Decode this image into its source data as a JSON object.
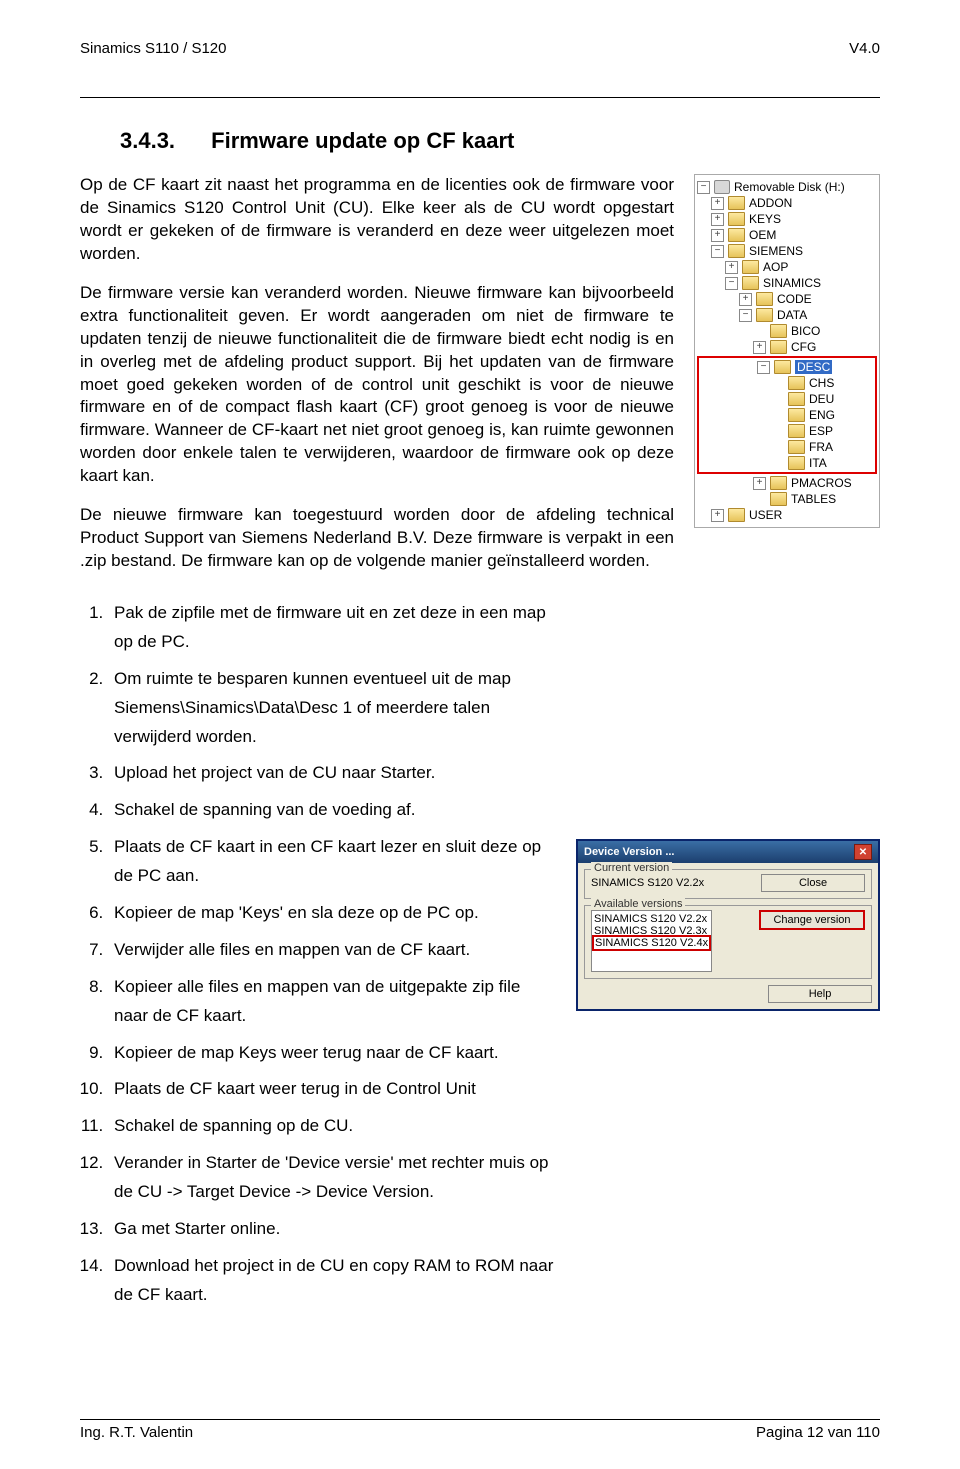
{
  "header": {
    "left": "Sinamics S110 / S120",
    "right": "V4.0"
  },
  "heading": {
    "num": "3.4.3.",
    "title": "Firmware update op CF kaart"
  },
  "paragraphs": {
    "p1": "Op de CF kaart zit naast het programma en de licenties ook de firmware voor de Sinamics S120 Control Unit (CU). Elke keer als de CU wordt opgestart wordt er gekeken of de firmware is veranderd en deze weer uitgelezen moet worden.",
    "p2": "De firmware versie kan veranderd worden. Nieuwe firmware kan bijvoorbeeld extra functionaliteit geven. Er wordt aangeraden om niet de firmware te updaten tenzij de nieuwe functionaliteit die de firmware biedt echt nodig is en in overleg met de afdeling product support. Bij het updaten van de firmware moet goed gekeken worden of de control unit geschikt is voor de nieuwe firmware en of de compact flash kaart (CF) groot genoeg is voor de nieuwe firmware. Wanneer de CF-kaart net niet groot genoeg is, kan ruimte gewonnen worden door enkele talen te verwijderen, waardoor de firmware ook op deze kaart kan.",
    "p3": "De nieuwe firmware kan toegestuurd worden door de afdeling technical Product Support van Siemens Nederland B.V. Deze firmware is verpakt in een .zip bestand. De firmware kan op de volgende manier geïnstalleerd worden."
  },
  "tree": {
    "root": "Removable Disk (H:)",
    "nodes": [
      {
        "lvl": 2,
        "pm": "+",
        "label": "ADDON"
      },
      {
        "lvl": 2,
        "pm": "+",
        "label": "KEYS"
      },
      {
        "lvl": 2,
        "pm": "+",
        "label": "OEM"
      },
      {
        "lvl": 2,
        "pm": "-",
        "label": "SIEMENS"
      },
      {
        "lvl": 3,
        "pm": "+",
        "label": "AOP"
      },
      {
        "lvl": 3,
        "pm": "-",
        "label": "SINAMICS"
      },
      {
        "lvl": 4,
        "pm": "+",
        "label": "CODE"
      },
      {
        "lvl": 4,
        "pm": "-",
        "label": "DATA"
      },
      {
        "lvl": 5,
        "pm": " ",
        "label": "BICO"
      },
      {
        "lvl": 5,
        "pm": "+",
        "label": "CFG"
      },
      {
        "lvl": 5,
        "pm": "-",
        "label": "DESC",
        "selected": true,
        "redstart": true
      },
      {
        "lvl": 6,
        "pm": " ",
        "label": "CHS"
      },
      {
        "lvl": 6,
        "pm": " ",
        "label": "DEU"
      },
      {
        "lvl": 6,
        "pm": " ",
        "label": "ENG"
      },
      {
        "lvl": 6,
        "pm": " ",
        "label": "ESP"
      },
      {
        "lvl": 6,
        "pm": " ",
        "label": "FRA"
      },
      {
        "lvl": 6,
        "pm": " ",
        "label": "ITA",
        "redend": true
      },
      {
        "lvl": 5,
        "pm": "+",
        "label": "PMACROS"
      },
      {
        "lvl": 5,
        "pm": " ",
        "label": "TABLES"
      },
      {
        "lvl": 2,
        "pm": "+",
        "label": "USER"
      }
    ]
  },
  "steps": [
    "Pak de zipfile met de firmware uit en zet deze in een map op de PC.",
    "Om ruimte te besparen kunnen eventueel uit de map Siemens\\Sinamics\\Data\\Desc 1 of meerdere talen verwijderd worden.",
    "Upload het project van de CU naar Starter.",
    "Schakel de spanning van de voeding af.",
    "Plaats de CF kaart in een CF kaart lezer en sluit deze op de PC aan.",
    "Kopieer de map 'Keys' en sla deze op de PC op.",
    "Verwijder alle files en mappen van de CF kaart.",
    "Kopieer alle files en mappen van de uitgepakte zip file naar de CF kaart.",
    "Kopieer de map Keys weer terug naar de CF kaart.",
    "Plaats de CF kaart weer terug in de Control Unit",
    "Schakel de spanning op de CU.",
    "Verander in Starter de 'Device versie' met rechter muis op de CU -> Target Device -> Device Version.",
    "Ga met Starter online.",
    "Download het project in de CU en copy RAM to ROM naar de CF kaart."
  ],
  "dialog": {
    "title": "Device Version ...",
    "current_group": "Current version",
    "current_value": "SINAMICS S120 V2.2x",
    "close": "Close",
    "avail_group": "Available versions",
    "versions": [
      "SINAMICS S120 V2.2x",
      "SINAMICS S120 V2.3x",
      "SINAMICS S120 V2.4x"
    ],
    "change": "Change version",
    "help": "Help"
  },
  "footer": {
    "left": "Ing. R.T. Valentin",
    "right": "Pagina 12 van 110"
  }
}
